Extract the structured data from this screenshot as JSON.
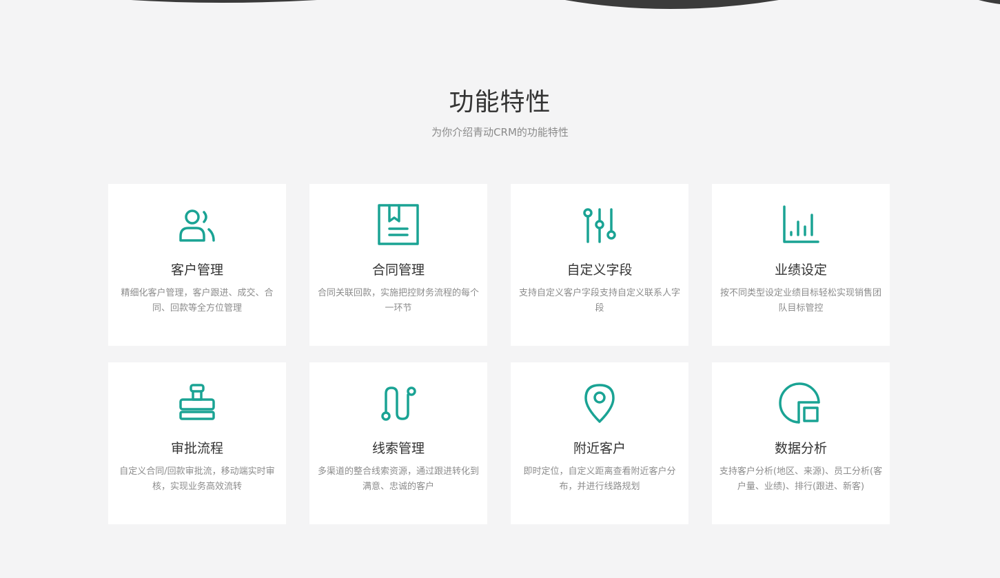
{
  "section": {
    "title": "功能特性",
    "subtitle": "为你介绍青动CRM的功能特性"
  },
  "accent_color": "#1aa394",
  "features": [
    {
      "icon": "users-icon",
      "title": "客户管理",
      "desc": "精细化客户管理，客户跟进、成交、合同、回款等全方位管理"
    },
    {
      "icon": "book-icon",
      "title": "合同管理",
      "desc": "合同关联回款，实施把控财务流程的每个一环节"
    },
    {
      "icon": "sliders-icon",
      "title": "自定义字段",
      "desc": "支持自定义客户字段支持自定义联系人字段"
    },
    {
      "icon": "bar-chart-icon",
      "title": "业绩设定",
      "desc": "按不同类型设定业绩目标轻松实现销售团队目标管控"
    },
    {
      "icon": "stamp-icon",
      "title": "审批流程",
      "desc": "自定义合同/回款审批流，移动端实时审核，实现业务高效流转"
    },
    {
      "icon": "route-icon",
      "title": "线索管理",
      "desc": "多渠道的整合线索资源，通过跟进转化到满意、忠诚的客户"
    },
    {
      "icon": "map-pin-icon",
      "title": "附近客户",
      "desc": "即时定位，自定义距离查看附近客户分布，并进行线路规划"
    },
    {
      "icon": "pie-chart-icon",
      "title": "数据分析",
      "desc": "支持客户分析(地区、来源)、员工分析(客户量、业绩)、排行(跟进、新客)"
    }
  ]
}
